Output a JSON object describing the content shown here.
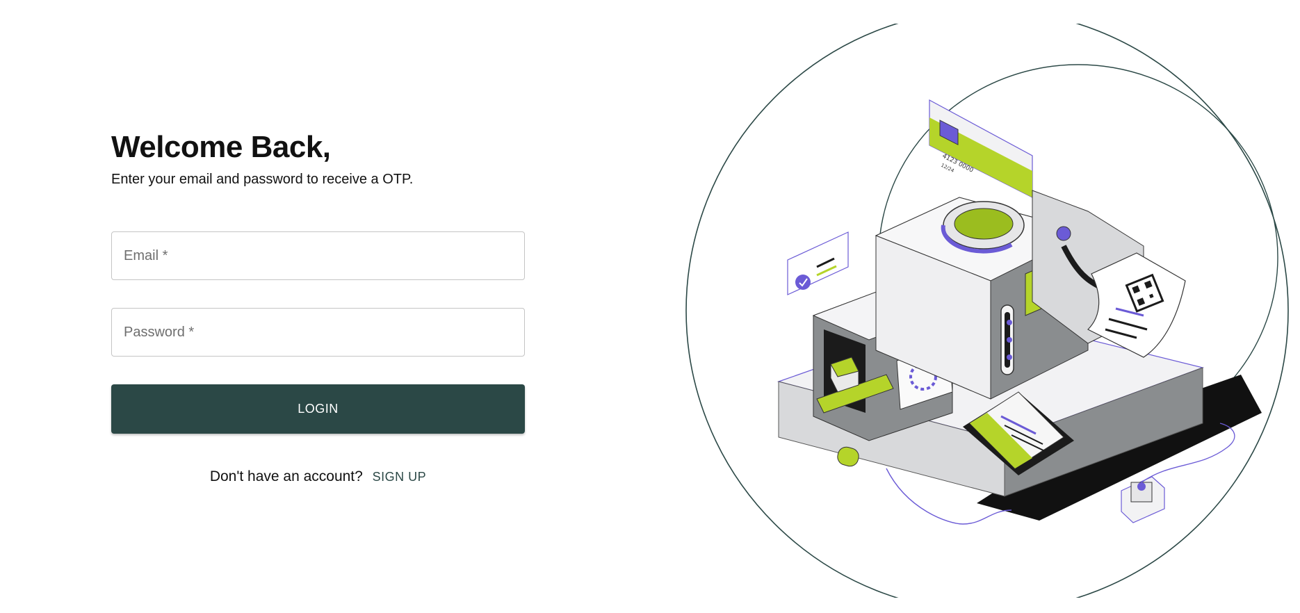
{
  "login": {
    "title": "Welcome Back,",
    "subtitle": "Enter your email and password to receive a OTP.",
    "email_placeholder": "Email *",
    "password_placeholder": "Password *",
    "login_label": "LOGIN",
    "signup_prompt": "Don't have an account?",
    "signup_label": "SIGN UP"
  },
  "illustration": {
    "card_number": "4123 0000",
    "card_expiry": "12/24",
    "screen_password": "*****"
  },
  "colors": {
    "primary": "#2b4846",
    "accent_lime": "#b5d42a",
    "accent_purple": "#6b5bd6",
    "machine_gray": "#8a8d8f"
  }
}
